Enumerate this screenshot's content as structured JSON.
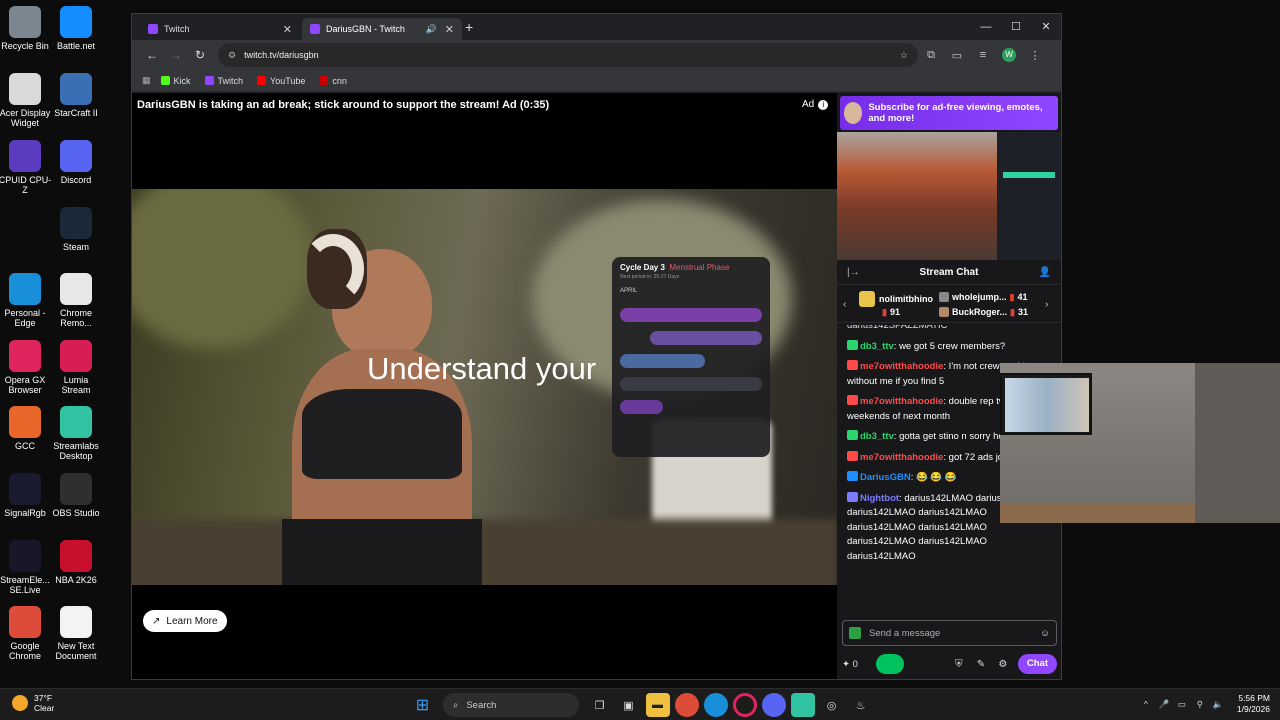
{
  "desktop": {
    "icons": [
      {
        "label": "Recycle Bin",
        "icon": "recycle-bin-icon",
        "color": "#7a8791"
      },
      {
        "label": "Battle.net",
        "icon": "battlenet-icon",
        "color": "#148eff"
      },
      {
        "label": "Acer Display Widget",
        "icon": "acer-display-icon",
        "color": "#d9d9d9"
      },
      {
        "label": "StarCraft II",
        "icon": "starcraft-icon",
        "color": "#3b6fb3"
      },
      {
        "label": "CPUID CPU-Z",
        "icon": "cpuz-icon",
        "color": "#5b3cbf"
      },
      {
        "label": "Discord",
        "icon": "discord-icon",
        "color": "#5865f2"
      },
      {
        "label": "Steam",
        "icon": "steam-icon",
        "color": "#1b2838"
      },
      {
        "label": "Personal - Edge",
        "icon": "edge-icon",
        "color": "#1a8fd9"
      },
      {
        "label": "Chrome Remo...",
        "icon": "chrome-remote-icon",
        "color": "#e8e8e8"
      },
      {
        "label": "Opera GX Browser",
        "icon": "opera-gx-icon",
        "color": "#e0245e"
      },
      {
        "label": "Lumia Stream",
        "icon": "lumia-icon",
        "color": "#d81d55"
      },
      {
        "label": "GCC",
        "icon": "gcc-icon",
        "color": "#e8662a"
      },
      {
        "label": "Streamlabs Desktop",
        "icon": "streamlabs-icon",
        "color": "#31c3a2"
      },
      {
        "label": "SignalRgb",
        "icon": "signalrgb-icon",
        "color": "#1a1a2e"
      },
      {
        "label": "OBS Studio",
        "icon": "obs-icon",
        "color": "#302e31"
      },
      {
        "label": "StreamEle... SE.Live",
        "icon": "streamelements-icon",
        "color": "#18172a"
      },
      {
        "label": "NBA 2K26",
        "icon": "nba2k-icon",
        "color": "#c8102e"
      },
      {
        "label": "Google Chrome",
        "icon": "chrome-icon",
        "color": "#dd4b39"
      },
      {
        "label": "New Text Document",
        "icon": "text-document-icon",
        "color": "#f3f3f3"
      }
    ]
  },
  "browser": {
    "tabs": [
      {
        "title": "Twitch"
      },
      {
        "title": "DariusGBN - Twitch"
      }
    ],
    "url": "twitch.tv/dariusgbn",
    "profile_initial": "W",
    "bookmarks": [
      {
        "label": "Kick",
        "color": "#53fc18"
      },
      {
        "label": "Twitch",
        "color": "#9146ff"
      },
      {
        "label": "YouTube",
        "color": "#ff0000"
      },
      {
        "label": "cnn",
        "color": "#cc0000"
      }
    ]
  },
  "player": {
    "ad_banner": "DariusGBN is taking an ad break; stick around to support the stream! Ad (0:35)",
    "ad_label": "Ad",
    "headline": "Understand your",
    "learn_more": "Learn More",
    "calendar": {
      "title": "Cycle Day 3",
      "phase": "Menstrual Phase",
      "subtitle": "Next period in: 25-27 Days",
      "month": "APRIL"
    }
  },
  "sidebar": {
    "sub_promo": "Subscribe for ad-free viewing, emotes, and more!",
    "chat_title": "Stream Chat",
    "leaderboard": [
      {
        "name": "nolimitbhino",
        "count": "91"
      },
      {
        "name": "wholejump...",
        "count": "41"
      },
      {
        "name": "BuckRoger...",
        "count": "31"
      }
    ],
    "partial_line": "darius142SPAZZMATIC",
    "messages": [
      {
        "user": "db3_ttv",
        "color": "#2bd46c",
        "text": ": we got 5 crew members?"
      },
      {
        "user": "me7owitthahoodie",
        "color": "#ff4a4a",
        "text": ": I'm not crew could run without me if you find 5"
      },
      {
        "user": "me7owitthahoodie",
        "color": "#ff4a4a",
        "text": ": double rep two weekends of next month"
      },
      {
        "user": "db3_ttv",
        "color": "#2bd46c",
        "text": ": gotta get stino n sorry hold on"
      },
      {
        "user": "me7owitthahoodie",
        "color": "#ff4a4a",
        "text": ": got 72 ads joining now"
      },
      {
        "user": "DariusGBN",
        "color": "#1e90ff",
        "text": ": 😂 😂 😂"
      },
      {
        "user": "Nightbot",
        "color": "#7c7cff",
        "text": ": darius142LMAO darius142LMAO darius142LMAO darius142LMAO darius142LMAO darius142LMAO darius142LMAO darius142LMAO darius142LMAO"
      }
    ],
    "input_placeholder": "Send a message",
    "points": "0",
    "chat_button": "Chat"
  },
  "taskbar": {
    "temp": "37°F",
    "condition": "Clear",
    "search": "Search",
    "time": "5:56 PM",
    "date": "1/9/2026"
  }
}
